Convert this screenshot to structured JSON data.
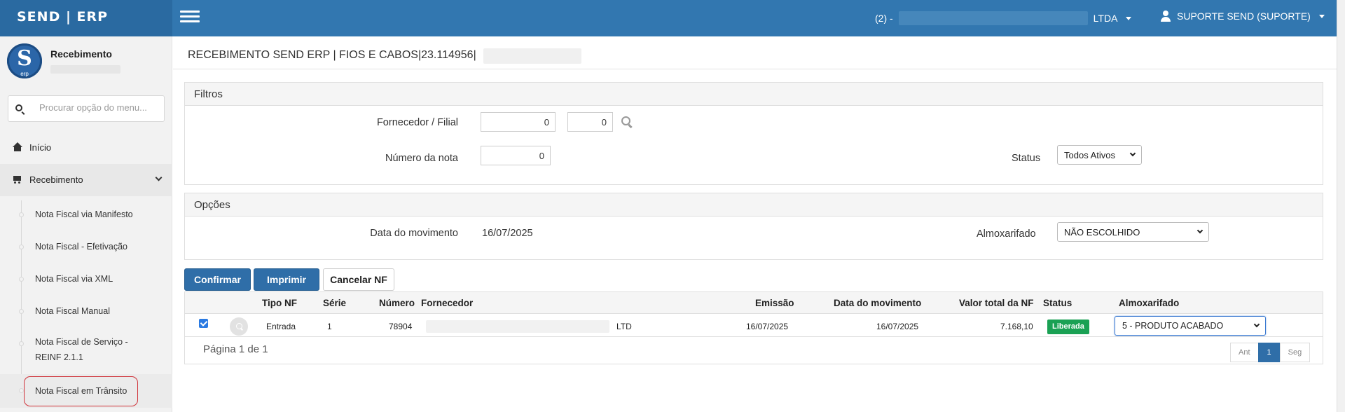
{
  "app": {
    "brand": "SEND | ERP"
  },
  "topbar": {
    "company_prefix": "(2) -",
    "company_suffix": "LTDA",
    "user": "SUPORTE SEND (SUPORTE)"
  },
  "sidebar": {
    "logo_letter": "S",
    "logo_sub": "erp",
    "profile_title": "Recebimento",
    "search_placeholder": "Procurar opção do menu...",
    "items": [
      {
        "label": "Início",
        "icon": "home-icon"
      },
      {
        "label": "Recebimento",
        "icon": "cart-icon"
      }
    ],
    "subitems": [
      {
        "label": "Nota Fiscal via Manifesto"
      },
      {
        "label": "Nota Fiscal - Efetivação"
      },
      {
        "label": "Nota Fiscal via XML"
      },
      {
        "label": "Nota Fiscal Manual"
      },
      {
        "label": "Nota Fiscal de Serviço - REINF 2.1.1"
      },
      {
        "label": "Nota Fiscal em Trânsito"
      }
    ]
  },
  "page": {
    "title": "RECEBIMENTO SEND ERP | FIOS E CABOS|23.114956|"
  },
  "filters": {
    "heading": "Filtros",
    "fornecedor_label": "Fornecedor / Filial",
    "fornecedor_value": "0",
    "filial_value": "0",
    "nota_label": "Número da nota",
    "nota_value": "0",
    "status_label": "Status",
    "status_value": "Todos Ativos"
  },
  "options": {
    "heading": "Opções",
    "data_label": "Data do movimento",
    "data_value": "16/07/2025",
    "almox_label": "Almoxarifado",
    "almox_value": "NÃO ESCOLHIDO"
  },
  "actions": {
    "confirm": "Confirmar",
    "print": "Imprimir",
    "cancel": "Cancelar NF"
  },
  "table": {
    "headers": {
      "tipo": "Tipo NF",
      "serie": "Série",
      "numero": "Número",
      "fornecedor": "Fornecedor",
      "emissao": "Emissão",
      "data_mov": "Data do movimento",
      "valor": "Valor total da NF",
      "status": "Status",
      "almox": "Almoxarifado"
    },
    "rows": [
      {
        "tipo": "Entrada",
        "serie": "1",
        "numero": "78904",
        "fornecedor_suffix": "LTD",
        "emissao": "16/07/2025",
        "data_mov": "16/07/2025",
        "valor": "7.168,10",
        "status": "Liberada",
        "almox": "5 - PRODUTO ACABADO"
      }
    ]
  },
  "pagination": {
    "summary": "Página 1 de 1",
    "prev": "Ant",
    "current": "1",
    "next": "Seg"
  },
  "colors": {
    "topbar": "#3277b0",
    "primary": "#2f6ea8",
    "success": "#1aa154",
    "highlight": "#d0333a"
  }
}
